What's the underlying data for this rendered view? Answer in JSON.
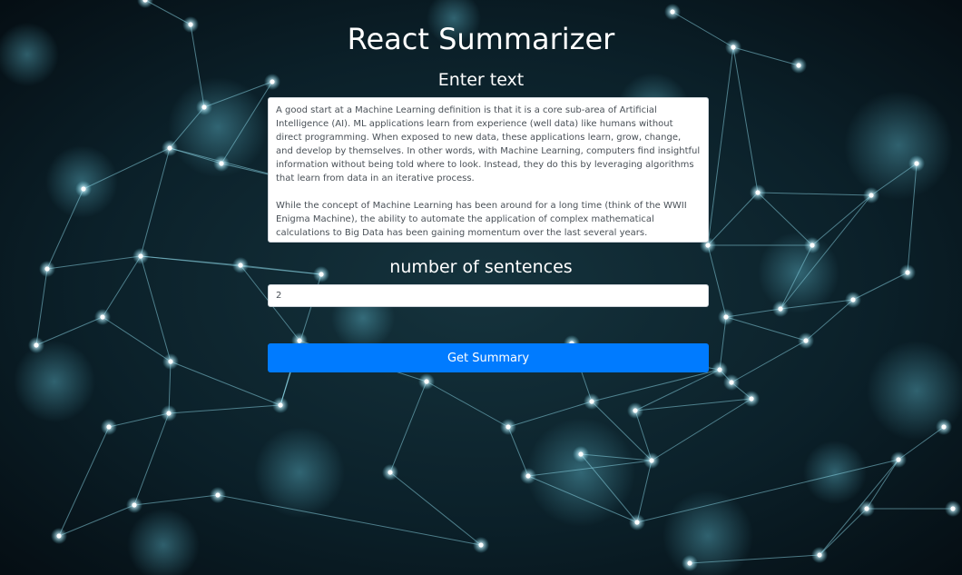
{
  "header": {
    "title": "React Summarizer"
  },
  "form": {
    "text_label": "Enter text",
    "text_value": "A good start at a Machine Learning definition is that it is a core sub-area of Artificial Intelligence (AI). ML applications learn from experience (well data) like humans without direct programming. When exposed to new data, these applications learn, grow, change, and develop by themselves. In other words, with Machine Learning, computers find insightful information without being told where to look. Instead, they do this by leveraging algorithms that learn from data in an iterative process.\n\nWhile the concept of Machine Learning has been around for a long time (think of the WWII Enigma Machine), the ability to automate the application of complex mathematical calculations to Big Data has been gaining momentum over the last several years.",
    "sentences_label": "number of sentences",
    "sentences_value": "2",
    "submit_label": "Get Summary"
  },
  "colors": {
    "button": "#007bff",
    "background": "#061218",
    "network_accent": "#6fd3e6"
  }
}
